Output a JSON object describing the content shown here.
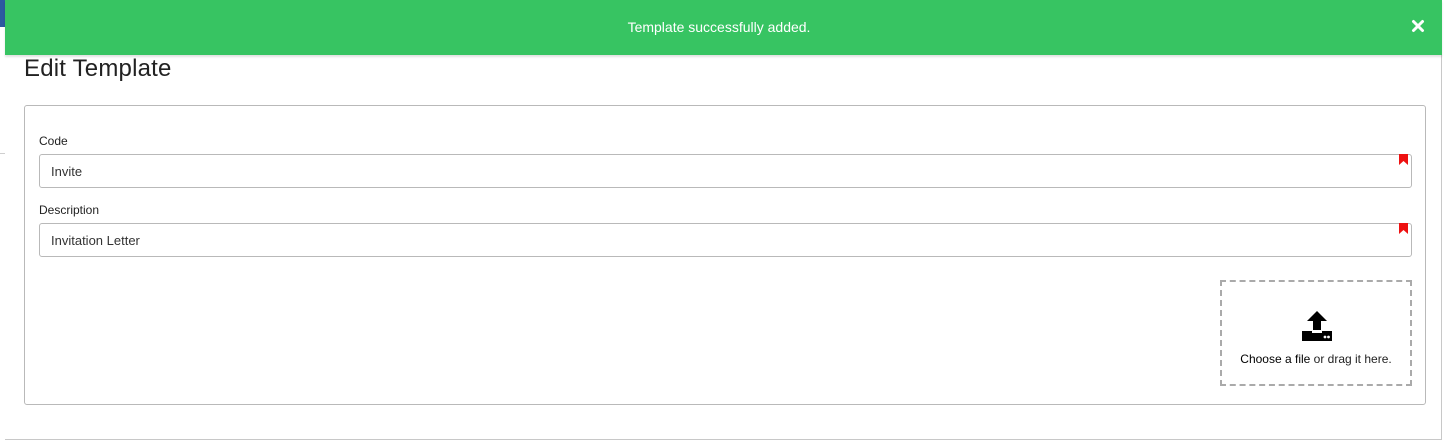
{
  "toast": {
    "message": "Template successfully added.",
    "close_icon": "close-icon",
    "color": "#37c462"
  },
  "page": {
    "title": "Edit Template"
  },
  "form": {
    "code": {
      "label": "Code",
      "value": "Invite",
      "required": true
    },
    "description": {
      "label": "Description",
      "value": "Invitation Letter",
      "required": true
    },
    "upload": {
      "icon": "upload-icon",
      "choose_label": "Choose a file",
      "hint": " or drag it here."
    }
  },
  "colors": {
    "required_flag": "#ee1111"
  }
}
